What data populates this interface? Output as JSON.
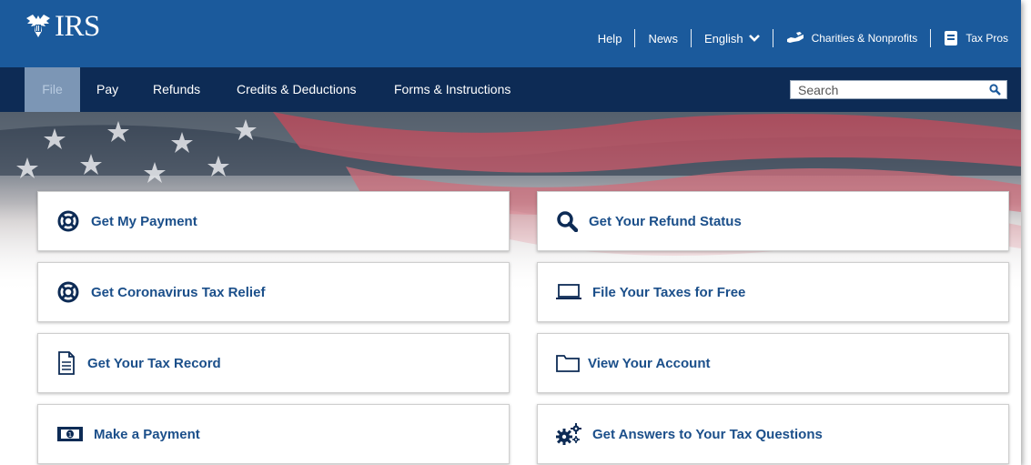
{
  "header": {
    "logo_text": "IRS",
    "utility_links": {
      "help": "Help",
      "news": "News",
      "language": "English",
      "charities": "Charities & Nonprofits",
      "taxpros": "Tax Pros"
    }
  },
  "nav": {
    "items": [
      "File",
      "Pay",
      "Refunds",
      "Credits & Deductions",
      "Forms & Instructions"
    ],
    "active": "File"
  },
  "search": {
    "placeholder": "Search"
  },
  "cards": {
    "get_my_payment": "Get My Payment",
    "get_refund_status": "Get Your Refund Status",
    "coronavirus_relief": "Get Coronavirus Tax Relief",
    "file_free": "File Your Taxes for Free",
    "tax_record": "Get Your Tax Record",
    "view_account": "View Your Account",
    "make_payment": "Make a Payment",
    "tax_questions": "Get Answers to Your Tax Questions"
  },
  "colors": {
    "header_blue": "#1b5a9c",
    "nav_navy": "#0d2b55",
    "active_tab": "#7c96b5",
    "link_blue": "#1b4f8a"
  }
}
